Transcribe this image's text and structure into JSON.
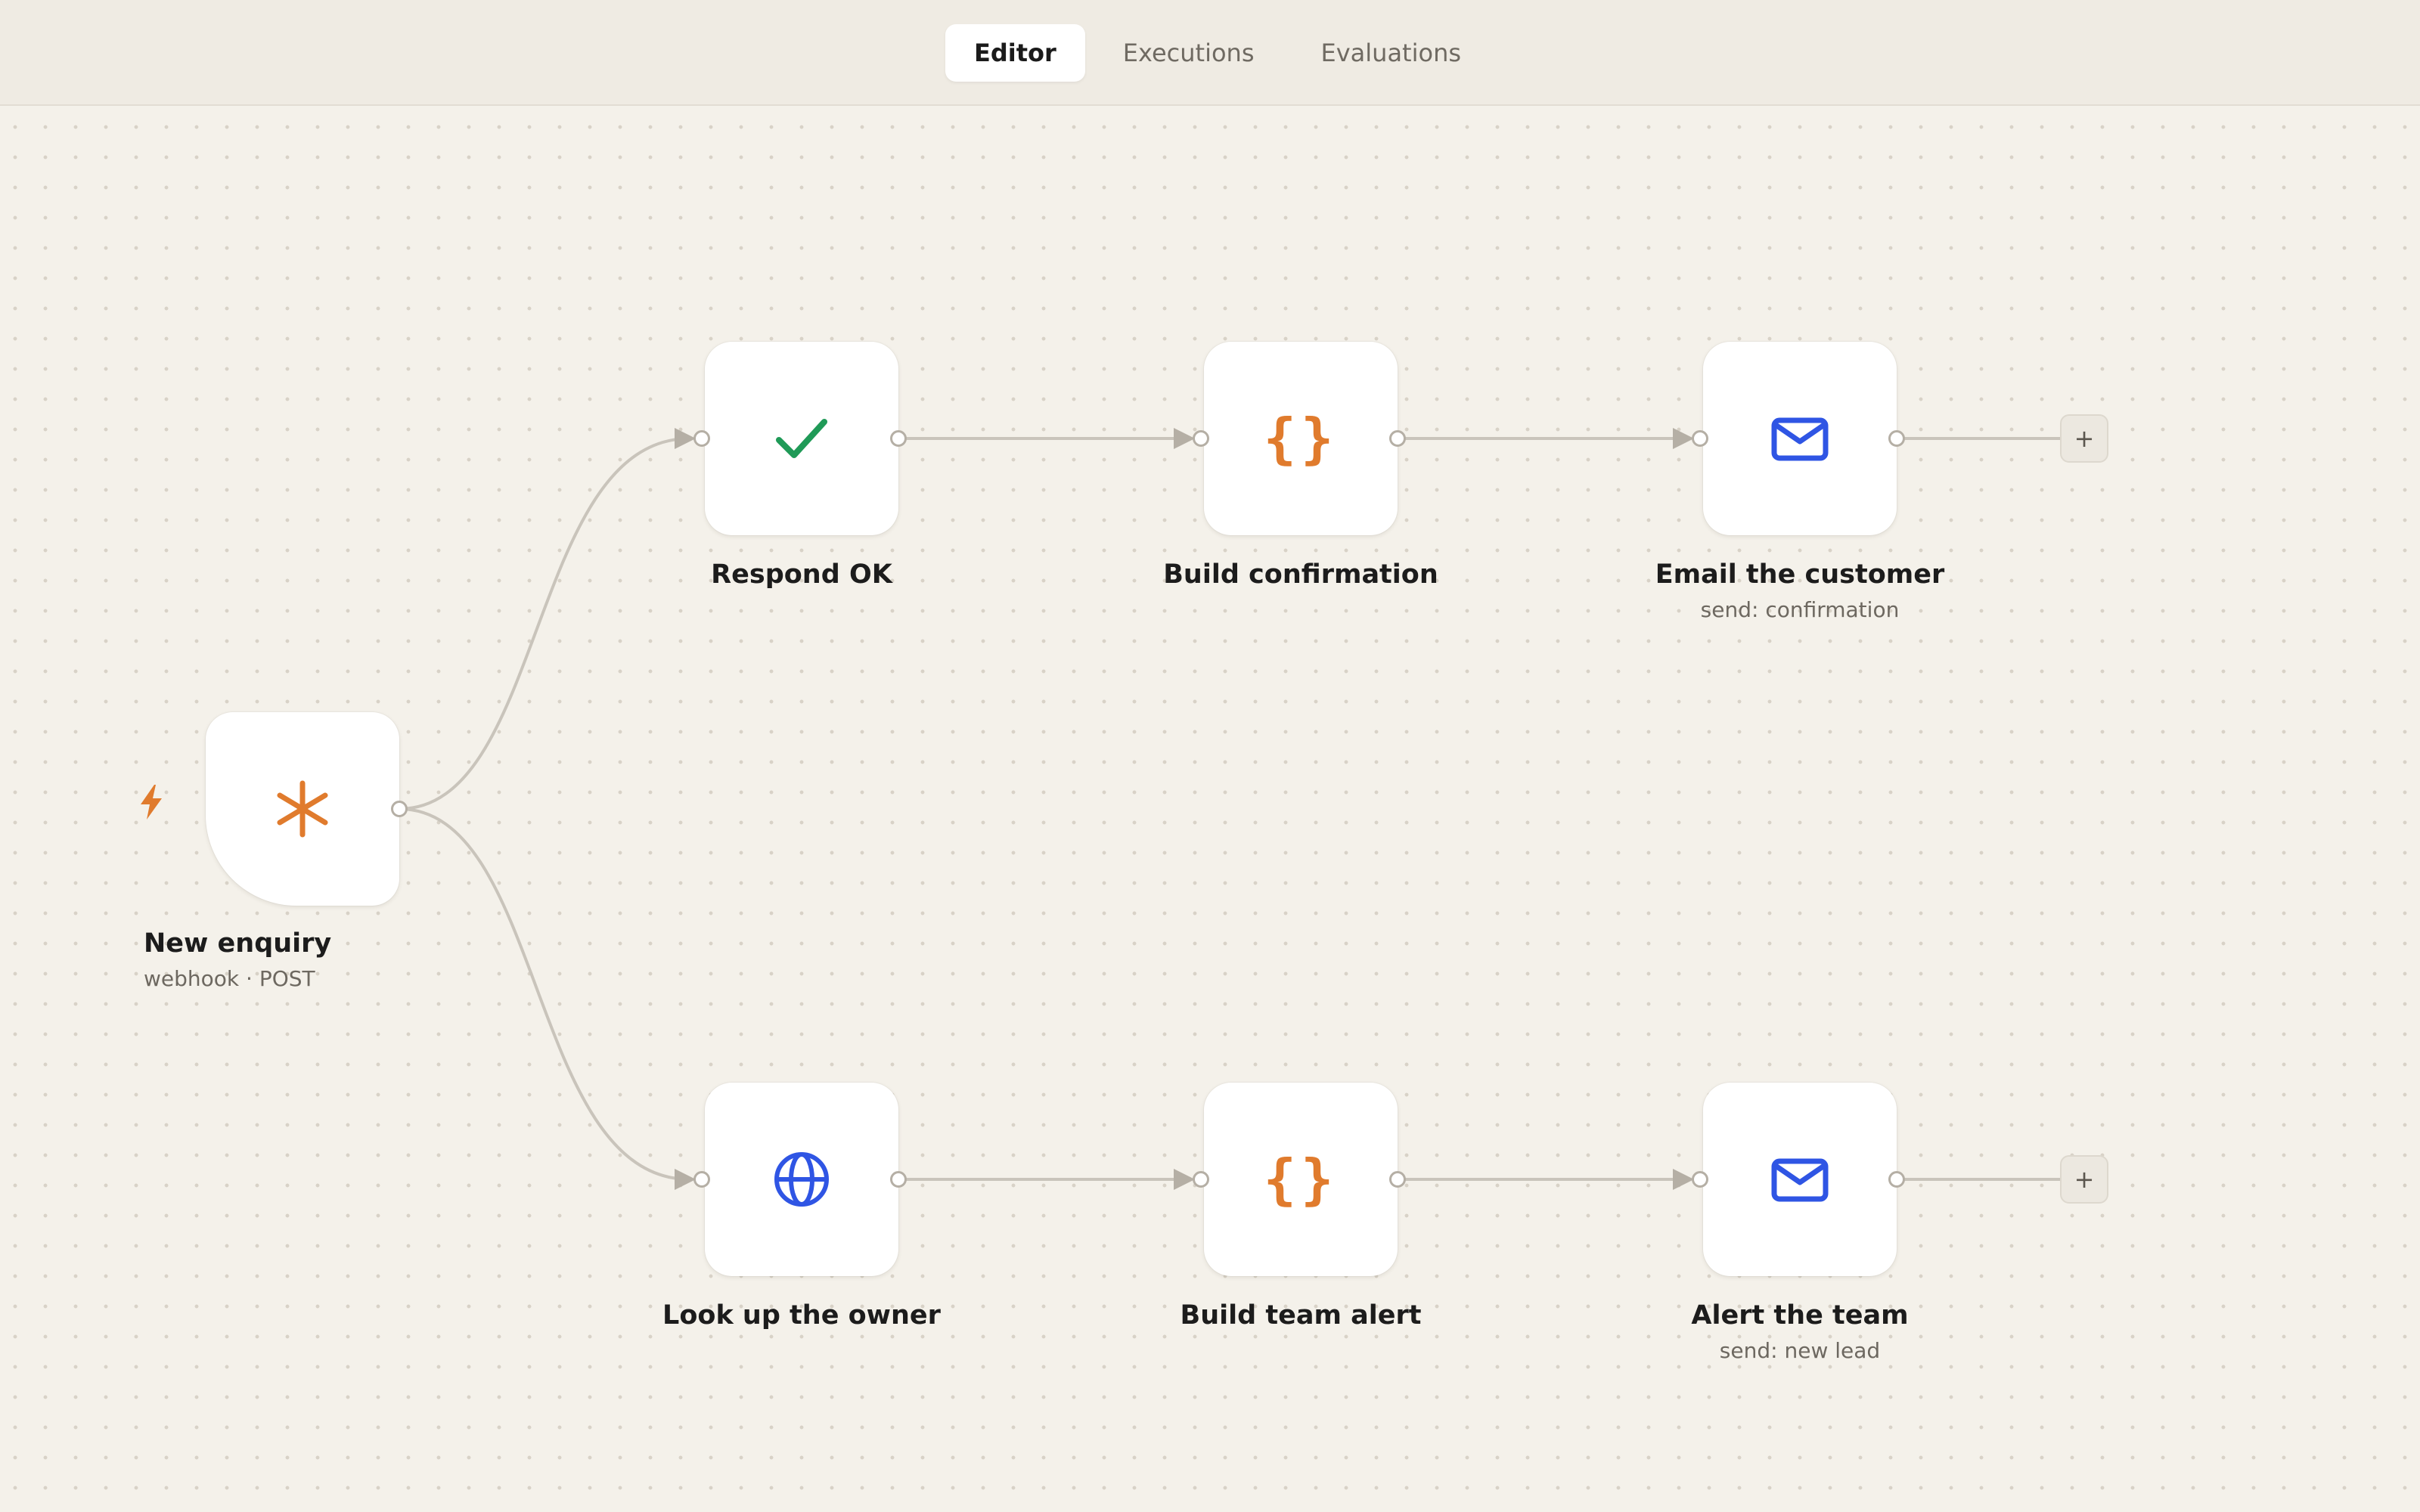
{
  "tabs": [
    {
      "label": "Editor",
      "active": true
    },
    {
      "label": "Executions",
      "active": false
    },
    {
      "label": "Evaluations",
      "active": false
    }
  ],
  "nodes": {
    "new_enquiry": {
      "label": "New enquiry",
      "sublabel": "webhook · POST",
      "icon": "asterisk-icon",
      "color": "#e07b2d"
    },
    "respond_ok": {
      "label": "Respond OK",
      "icon": "checkmark-icon",
      "color": "#1f9a57"
    },
    "build_confirmation": {
      "label": "Build confirmation",
      "icon": "code-braces-icon",
      "icon_text": "{}",
      "color": "#e07b2d"
    },
    "email_customer": {
      "label": "Email the customer",
      "sublabel": "send: confirmation",
      "icon": "mail-icon",
      "color": "#2f55e4"
    },
    "look_up_owner": {
      "label": "Look up the owner",
      "icon": "globe-icon",
      "color": "#2f55e4"
    },
    "build_team_alert": {
      "label": "Build team alert",
      "icon": "code-braces-icon",
      "icon_text": "{}",
      "color": "#e07b2d"
    },
    "alert_team": {
      "label": "Alert the team",
      "sublabel": "send: new lead",
      "icon": "mail-icon",
      "color": "#2f55e4"
    }
  },
  "add_button_label": "+",
  "trigger_icon": "lightning-bolt-icon",
  "colors": {
    "background": "#f4f1ea",
    "topbar": "#efebe3",
    "wire": "#c9c4bb",
    "accent_orange": "#e07b2d",
    "accent_blue": "#2f55e4",
    "accent_green": "#1f9a57"
  }
}
